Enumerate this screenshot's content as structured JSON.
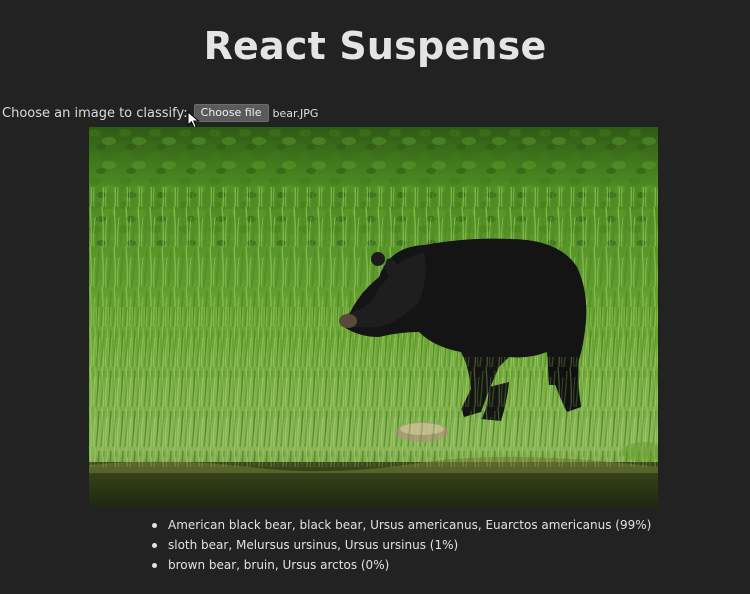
{
  "page": {
    "title": "React Suspense"
  },
  "picker": {
    "label": "Choose an image to classify:",
    "button_label": "Choose file",
    "selected_file": "bear.JPG"
  },
  "image": {
    "subject": "black bear walking through tall green grass beside water"
  },
  "results": [
    {
      "text": "American black bear, black bear, Ursus americanus, Euarctos americanus (99%)"
    },
    {
      "text": "sloth bear, Melursus ursinus, Ursus ursinus (1%)"
    },
    {
      "text": "brown bear, bruin, Ursus arctos (0%)"
    }
  ],
  "colors": {
    "background": "#222223",
    "text": "#e6e6e6",
    "button": "#5a5a5d"
  }
}
